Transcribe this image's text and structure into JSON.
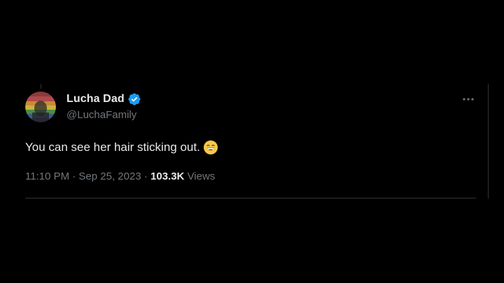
{
  "tweet": {
    "author": {
      "display_name": "Lucha Dad",
      "handle": "@LuchaFamily",
      "verified": true
    },
    "text": "You can see her hair sticking out.",
    "emoji": "grinning-face-with-smiling-eyes",
    "timestamp": "11:10 PM · Sep 25, 2023",
    "separator": " · ",
    "views_count": "103.3K",
    "views_label": "Views"
  },
  "colors": {
    "background": "#000000",
    "primary_text": "#e7e9ea",
    "secondary_text": "#71767b",
    "verified_blue": "#1d9bf0",
    "divider": "#2f3336"
  },
  "icons": {
    "verified": "verified-badge-icon",
    "more": "more-options-icon"
  }
}
